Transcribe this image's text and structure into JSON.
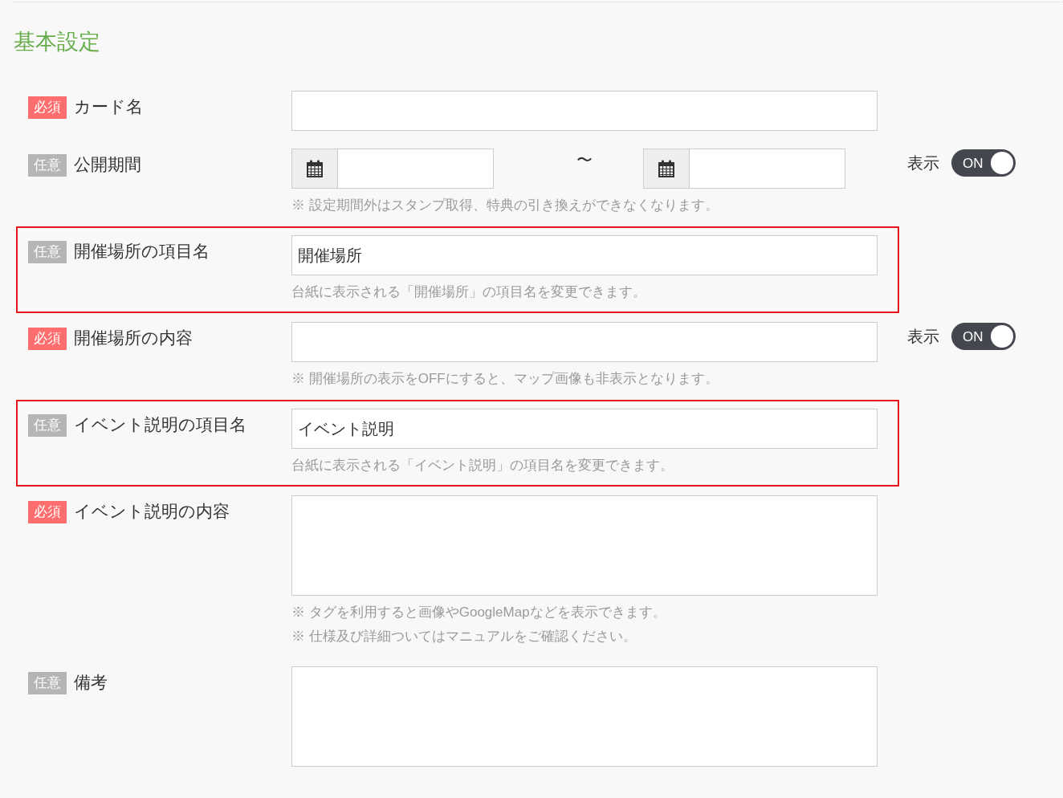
{
  "section": {
    "title": "基本設定"
  },
  "fields": [
    {
      "kind": "text",
      "required": true,
      "badge": "必須",
      "label": "カード名",
      "highlighted": false
    },
    {
      "kind": "date_range",
      "required": false,
      "badge": "任意",
      "label": "公開期間",
      "separator": "〜",
      "highlighted": false,
      "display_toggle": {
        "label": "表示",
        "state_label": "ON",
        "on": true
      },
      "notes": [
        "※ 設定期間外はスタンプ取得、特典の引き換えができなくなります。"
      ]
    },
    {
      "kind": "text",
      "required": false,
      "badge": "任意",
      "label": "開催場所の項目名",
      "value": "開催場所",
      "highlighted": true,
      "notes": [
        "台紙に表示される「開催場所」の項目名を変更できます。"
      ]
    },
    {
      "kind": "text",
      "required": true,
      "badge": "必須",
      "label": "開催場所の内容",
      "highlighted": false,
      "display_toggle": {
        "label": "表示",
        "state_label": "ON",
        "on": true
      },
      "notes": [
        "※ 開催場所の表示をOFFにすると、マップ画像も非表示となります。"
      ]
    },
    {
      "kind": "text",
      "required": false,
      "badge": "任意",
      "label": "イベント説明の項目名",
      "value": "イベント説明",
      "highlighted": true,
      "notes": [
        "台紙に表示される「イベント説明」の項目名を変更できます。"
      ]
    },
    {
      "kind": "textarea",
      "required": true,
      "badge": "必須",
      "label": "イベント説明の内容",
      "highlighted": false,
      "notes": [
        "※ タグを利用すると画像やGoogleMapなどを表示できます。",
        "※ 仕様及び詳細ついてはマニュアルをご確認ください。"
      ]
    },
    {
      "kind": "textarea",
      "required": false,
      "badge": "任意",
      "label": "備考",
      "highlighted": false
    }
  ]
}
